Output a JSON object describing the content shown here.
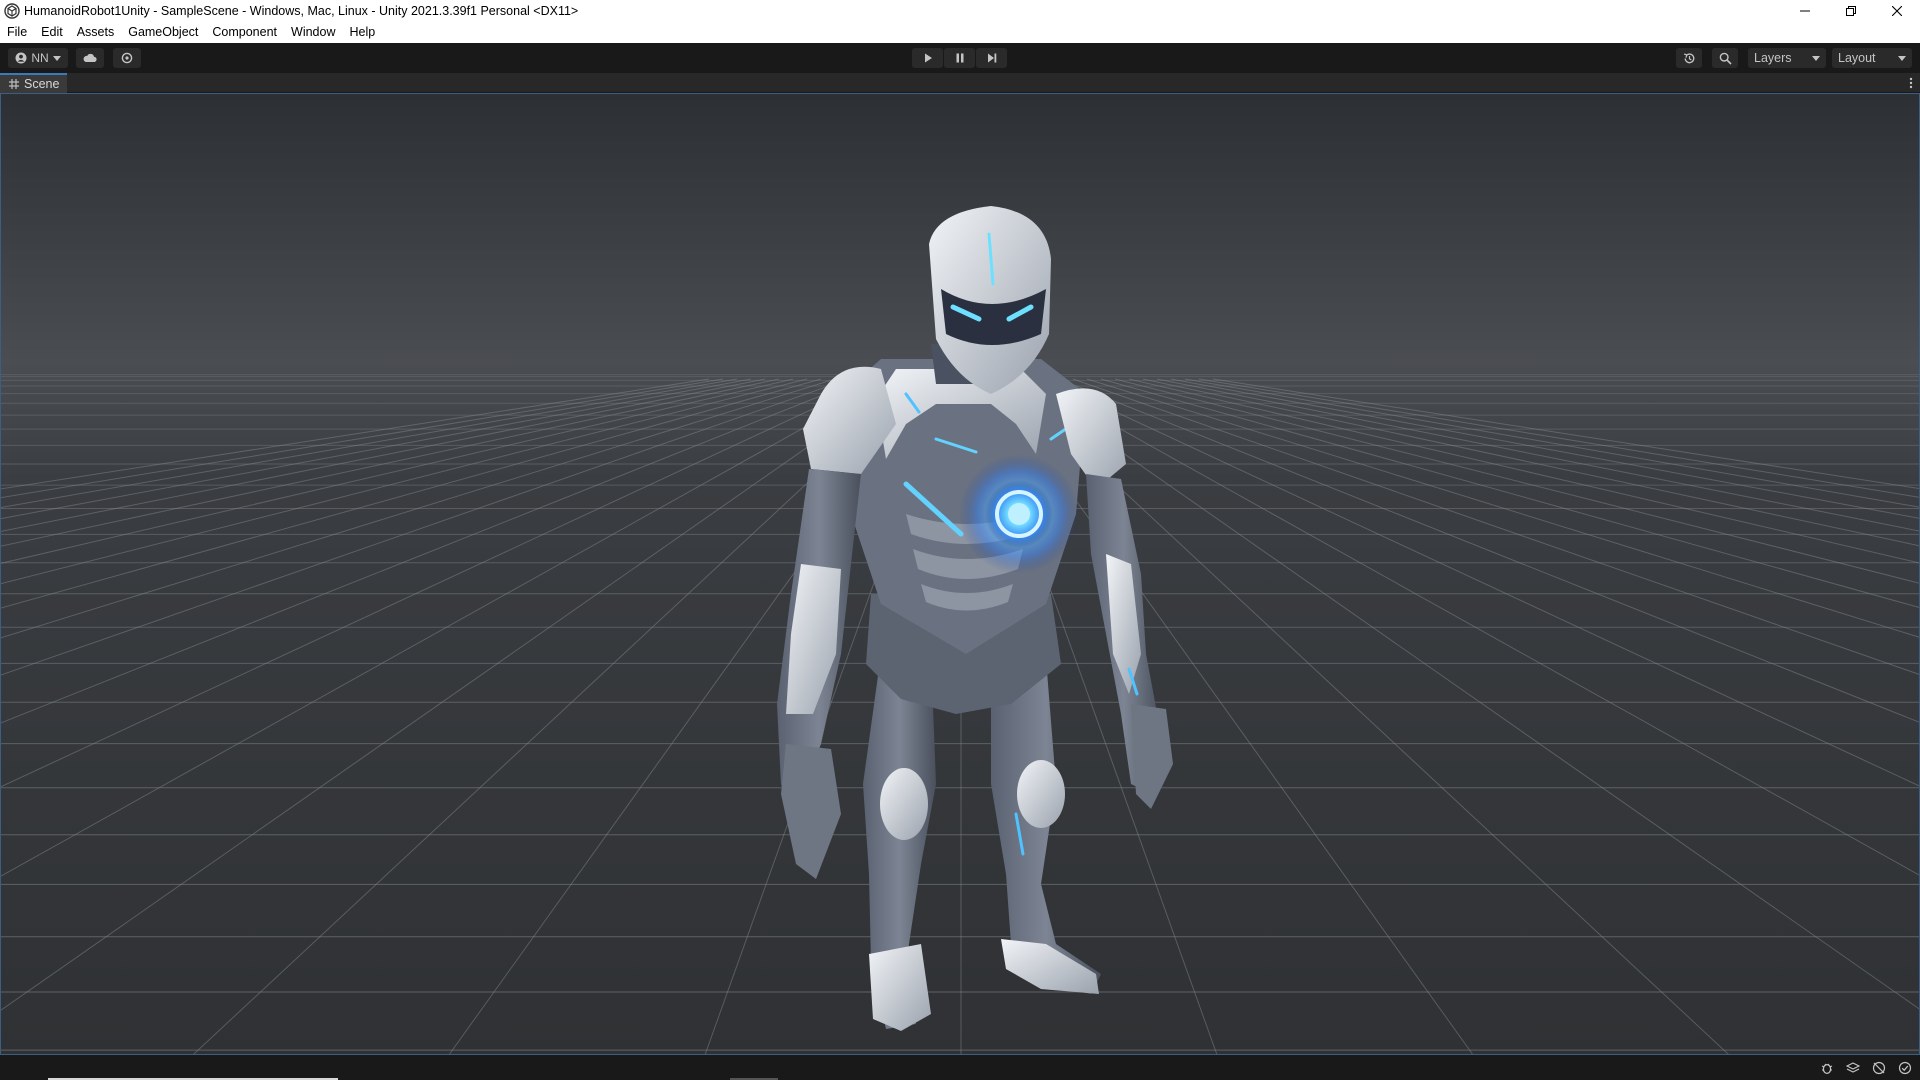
{
  "window": {
    "title": "HumanoidRobot1Unity - SampleScene - Windows, Mac, Linux - Unity 2021.3.39f1 Personal <DX11>",
    "icon": "unity-logo-icon"
  },
  "menu": {
    "items": [
      "File",
      "Edit",
      "Assets",
      "GameObject",
      "Component",
      "Window",
      "Help"
    ]
  },
  "toolbar": {
    "account_label": "NN",
    "layers_label": "Layers",
    "layout_label": "Layout"
  },
  "scene": {
    "tab_label": "Scene"
  },
  "colors": {
    "accent": "#3a79bb",
    "robot_glow": "#4fc3ff",
    "background": "#191919"
  }
}
